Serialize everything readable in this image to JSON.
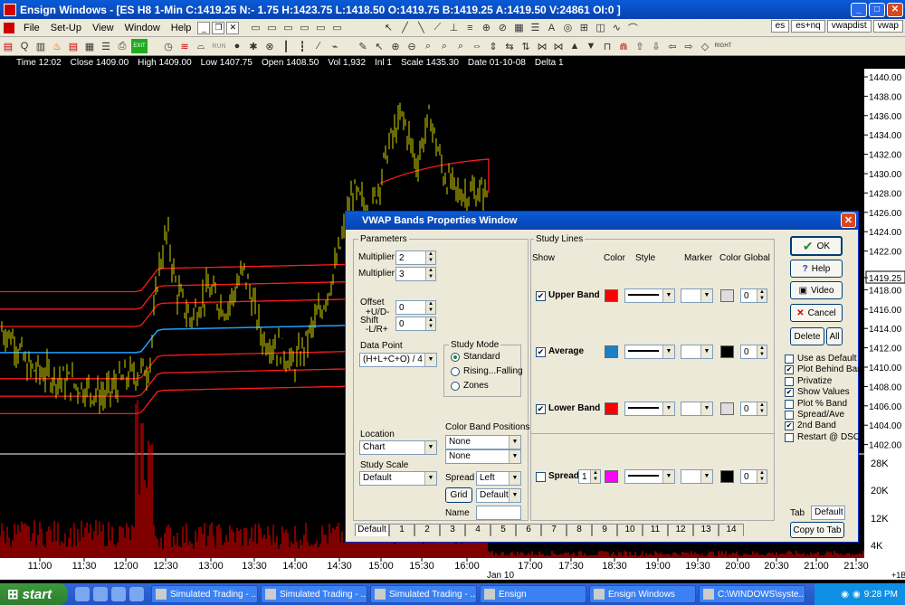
{
  "window": {
    "title": "Ensign Windows - [ES H8 1-Min C:1419.25 N:- 1.75 H:1423.75 L:1418.50 O:1419.75 B:1419.25 A:1419.50 V:24861 OI:0 ]"
  },
  "menu": [
    "File",
    "Set-Up",
    "View",
    "Window",
    "Help"
  ],
  "toolbar": {
    "run_label": "RUN",
    "exit_label": "EXIT",
    "right_label": "RIGHT"
  },
  "chart_tabs": [
    "es",
    "es+nq",
    "vwapdist",
    "vwap"
  ],
  "info": {
    "time": "Time 12:02",
    "close": "Close 1409.00",
    "high": "High 1409.00",
    "low": "Low 1407.75",
    "open": "Open 1408.50",
    "vol": "Vol 1,932",
    "int": "Inl 1",
    "scale": "Scale 1435.30",
    "date": "Date 01-10-08",
    "delta": "Delta 1"
  },
  "chart_data": {
    "type": "line",
    "price_axis": [
      "1440.00",
      "1438.00",
      "1436.00",
      "1434.00",
      "1432.00",
      "1430.00",
      "1428.00",
      "1426.00",
      "1424.00",
      "1422.00",
      "1419.25",
      "1418.00",
      "1416.00",
      "1414.00",
      "1412.00",
      "1410.00",
      "1408.00",
      "1406.00",
      "1404.00",
      "1402.00"
    ],
    "current_price": "1419.25",
    "volume_axis": [
      "28K",
      "20K",
      "12K",
      "4K"
    ],
    "time_axis": [
      "11:00",
      "11:30",
      "12:00",
      "12:30",
      "13:00",
      "13:30",
      "14:00",
      "14:30",
      "15:00",
      "15:30",
      "16:00",
      "17:00",
      "17:30",
      "18:30",
      "19:00",
      "19:30",
      "20:00",
      "20:30",
      "21:00",
      "21:30"
    ],
    "date_label": "Jan 10",
    "corner_label": "+1B",
    "colors": {
      "price": "#d4d400",
      "bands": "#ff1a1a",
      "average": "#1ea0ff",
      "volume": "#ff0000"
    }
  },
  "dialog": {
    "title": "VWAP Bands Properties Window",
    "parameters_label": "Parameters",
    "multiplier1_label": "Multiplier 1",
    "multiplier1_value": "2",
    "multiplier2_label": "Multiplier 2",
    "multiplier2_value": "3",
    "offset_label": "Offset",
    "offset_sub": "+U/D-",
    "offset_value": "0",
    "shift_label": "Shift",
    "shift_sub": "-L/R+",
    "shift_value": "0",
    "datapoint_label": "Data Point",
    "datapoint_value": "(H+L+C+O) / 4",
    "studymode_label": "Study Mode",
    "modes": [
      "Standard",
      "Rising...Falling",
      "Zones"
    ],
    "location_label": "Location",
    "location_value": "Chart",
    "colorband_label": "Color Band Positions",
    "colorband1": "None",
    "colorband2": "None",
    "studyscale_label": "Study Scale",
    "studyscale_value": "Default",
    "spread_label": "Spread",
    "spread_value": "Left",
    "grid_label": "Grid",
    "grid_value": "Default",
    "name_label": "Name",
    "name_value": "",
    "studylines_label": "Study Lines",
    "col_show": "Show",
    "col_color": "Color",
    "col_style": "Style",
    "col_marker": "Marker",
    "col_color2": "Color",
    "col_global": "Global",
    "lines": [
      {
        "name": "Upper Band",
        "color": "#ff0000",
        "value": "0",
        "checked": true
      },
      {
        "name": "Average",
        "color": "#1e7fc8",
        "value": "0",
        "checked": true
      },
      {
        "name": "Lower Band",
        "color": "#ff0000",
        "value": "0",
        "checked": true
      },
      {
        "name": "Spread",
        "color": "#ff00ff",
        "value": "0",
        "checked": false,
        "spin": "1"
      }
    ],
    "buttons": {
      "ok": "OK",
      "help": "Help",
      "video": "Video",
      "cancel": "Cancel",
      "delete": "Delete",
      "all": "All"
    },
    "options": [
      {
        "label": "Use as Default",
        "checked": false
      },
      {
        "label": "Plot Behind Bars",
        "checked": true
      },
      {
        "label": "Privatize",
        "checked": false
      },
      {
        "label": "Show Values",
        "checked": true
      },
      {
        "label": "Plot % Band",
        "checked": false
      },
      {
        "label": "Spread/Ave",
        "checked": false
      },
      {
        "label": "2nd Band",
        "checked": true
      },
      {
        "label": "Restart @ DSO",
        "checked": false
      }
    ],
    "tab_label": "Tab",
    "tab_value": "Default",
    "copytotab": "Copy to Tab",
    "tabs": [
      "Default",
      "1",
      "2",
      "3",
      "4",
      "5",
      "6",
      "7",
      "8",
      "9",
      "10",
      "11",
      "12",
      "13",
      "14"
    ]
  },
  "taskbar": {
    "start": "start",
    "items": [
      "Simulated Trading - ...",
      "Simulated Trading - ...",
      "Simulated Trading - ...",
      "Ensign",
      "Ensign Windows",
      "C:\\WINDOWS\\syste..."
    ],
    "clock": "9:28 PM"
  }
}
